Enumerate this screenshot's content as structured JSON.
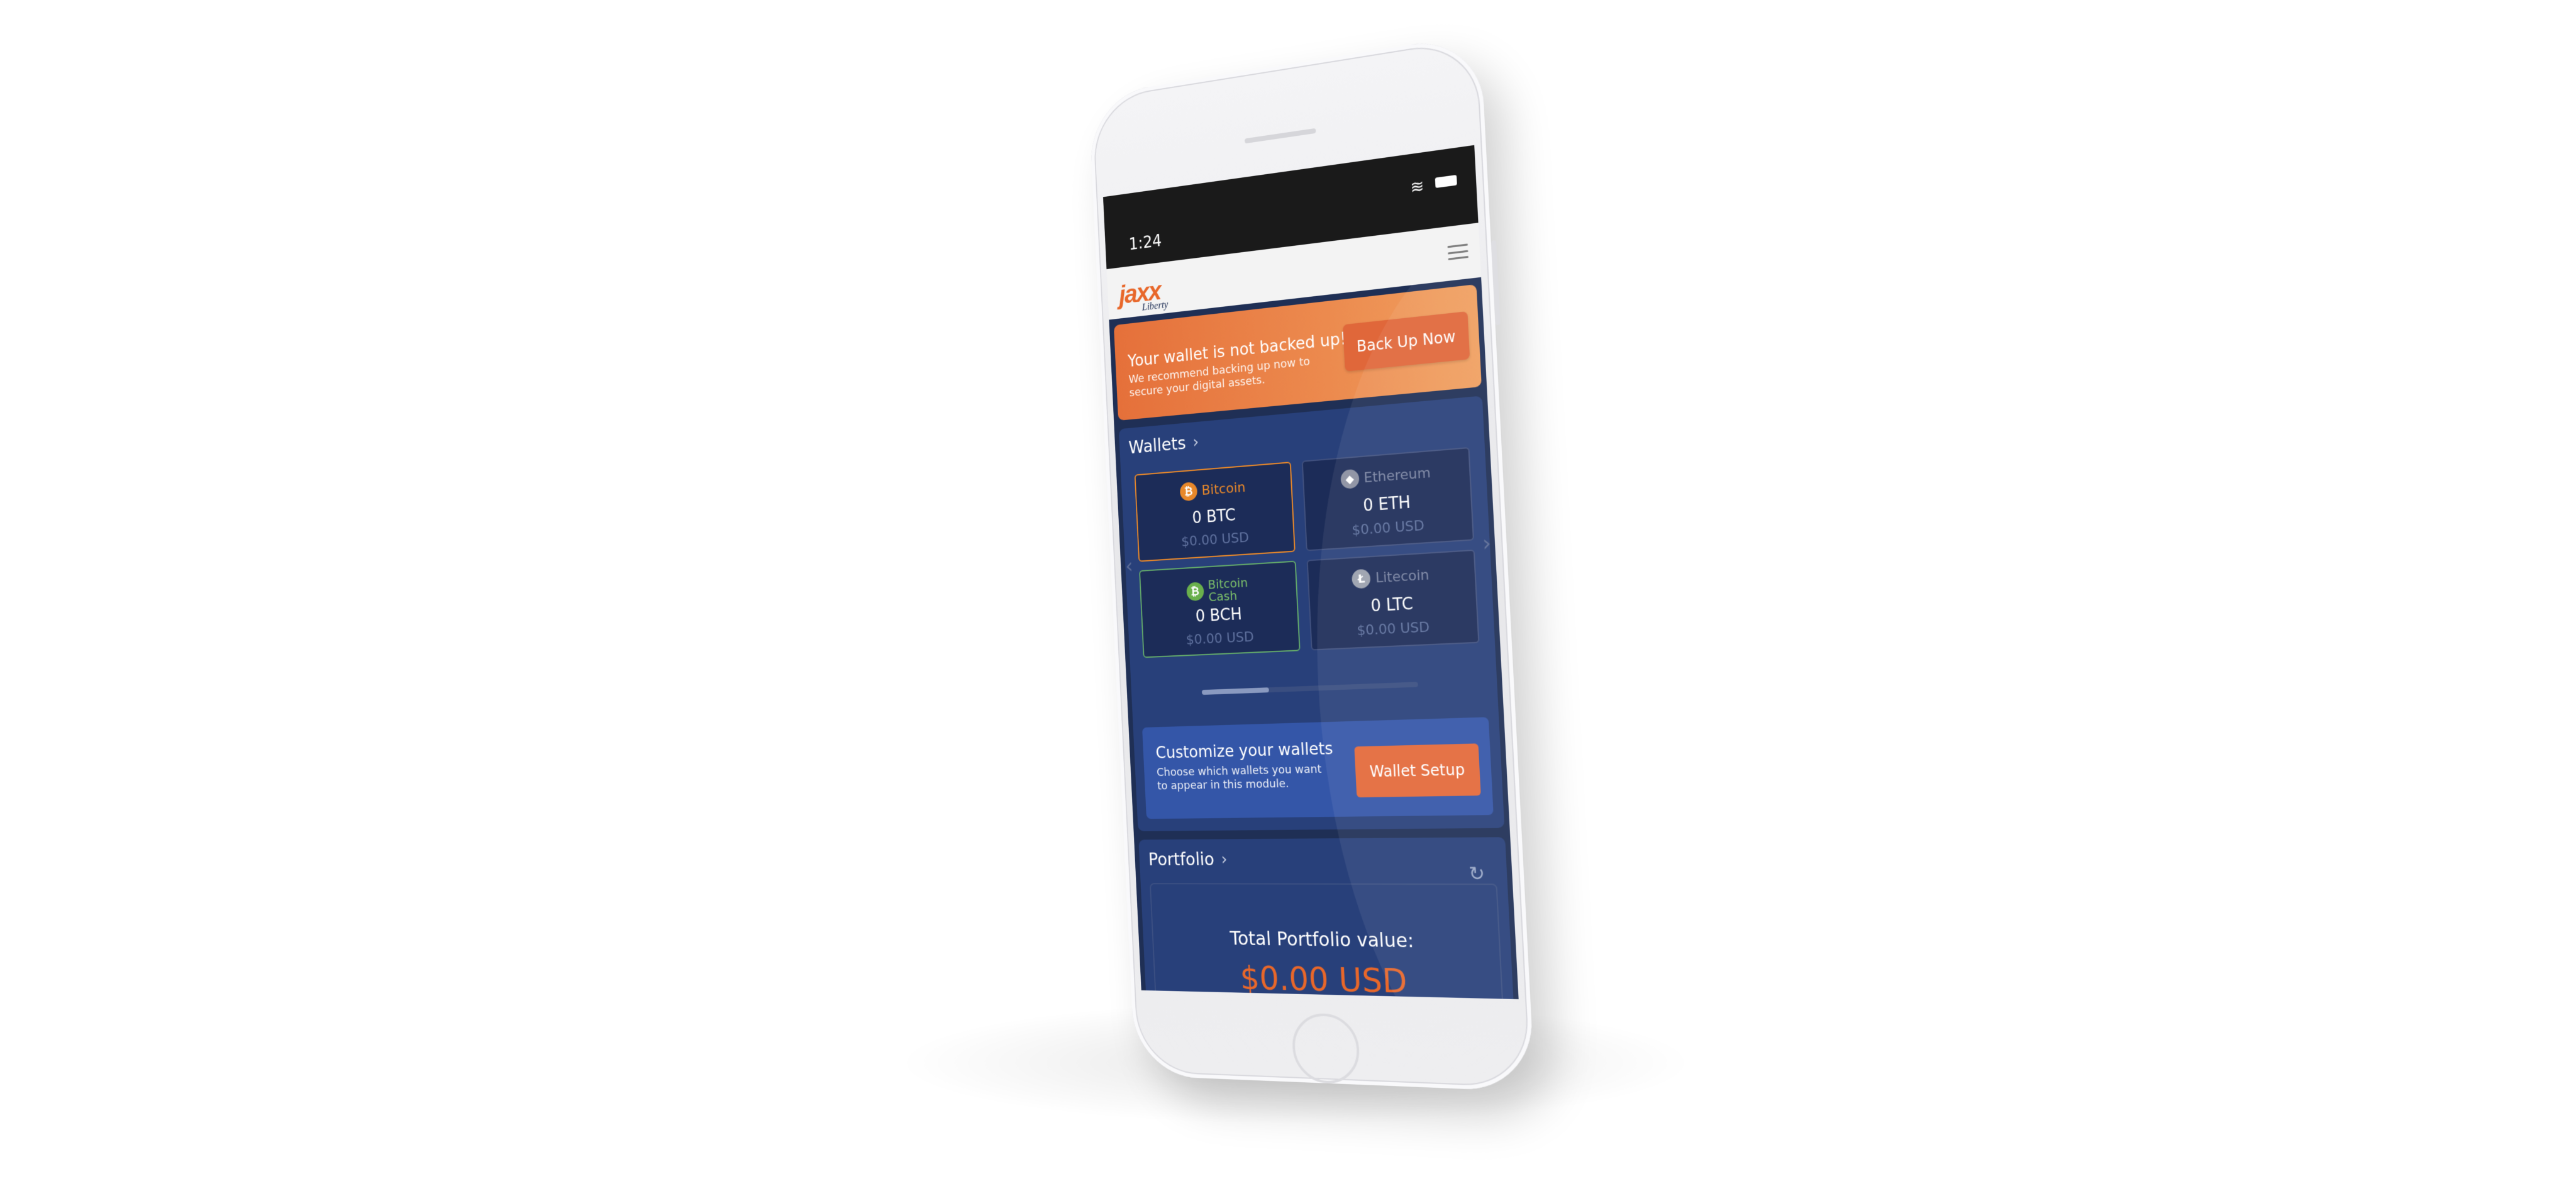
{
  "status": {
    "time": "1:24",
    "wifi_icon": "wifi-icon",
    "battery_icon": "battery-icon"
  },
  "app": {
    "logo": "jaxx",
    "logo_sub": "Liberty",
    "menu_icon": "hamburger-menu-icon"
  },
  "backup_banner": {
    "title": "Your wallet is not backed up!",
    "description": "We recommend backing up now to secure your digital assets.",
    "button": "Back Up Now"
  },
  "wallets": {
    "title": "Wallets",
    "items": [
      {
        "name": "Bitcoin",
        "amount": "0 BTC",
        "usd": "$0.00 USD",
        "color": "#e8882a",
        "icon": "bitcoin-icon",
        "glyph": "₿"
      },
      {
        "name": "Ethereum",
        "amount": "0 ETH",
        "usd": "$0.00 USD",
        "color": "#8a8fa0",
        "icon": "ethereum-icon",
        "glyph": "◆"
      },
      {
        "name": "Bitcoin Cash",
        "amount": "0 BCH",
        "usd": "$0.00 USD",
        "color": "#6ab04c",
        "icon": "bitcoin-cash-icon",
        "glyph": "₿"
      },
      {
        "name": "Litecoin",
        "amount": "0 LTC",
        "usd": "$0.00 USD",
        "color": "#9aa0ad",
        "icon": "litecoin-icon",
        "glyph": "Ł"
      }
    ],
    "scroll_position": 0.32
  },
  "customize": {
    "title": "Customize your wallets",
    "description": "Choose which wallets you want to appear in this module.",
    "button": "Wallet Setup"
  },
  "portfolio": {
    "title": "Portfolio",
    "label": "Total Portfolio value:",
    "value": "$0.00 USD"
  }
}
